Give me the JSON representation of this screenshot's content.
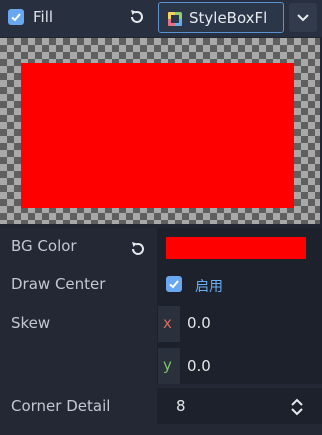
{
  "header": {
    "fill_label": "Fill",
    "stylebox_label": "StyleBoxFl"
  },
  "preview": {
    "fill_color": "#ff0000"
  },
  "properties": {
    "bg_color": {
      "label": "BG Color",
      "color": "#ff0000"
    },
    "draw_center": {
      "label": "Draw Center",
      "checkbox_text": "启用"
    },
    "skew": {
      "label": "Skew",
      "x_axis": "x",
      "x_value": "0.0",
      "y_axis": "y",
      "y_value": "0.0"
    },
    "corner_detail": {
      "label": "Corner Detail",
      "value": "8"
    }
  },
  "colors": {
    "accent": "#69a8f0",
    "axis_x": "#d9695e",
    "axis_y": "#7ec16b",
    "background": "#232834"
  },
  "icons": {
    "fill_checkbox": "checkmark-icon",
    "reset": "reset-icon",
    "stylebox": "stylebox-icon",
    "dropdown": "chevron-down-icon",
    "stepper": "up-down-arrows-icon"
  }
}
